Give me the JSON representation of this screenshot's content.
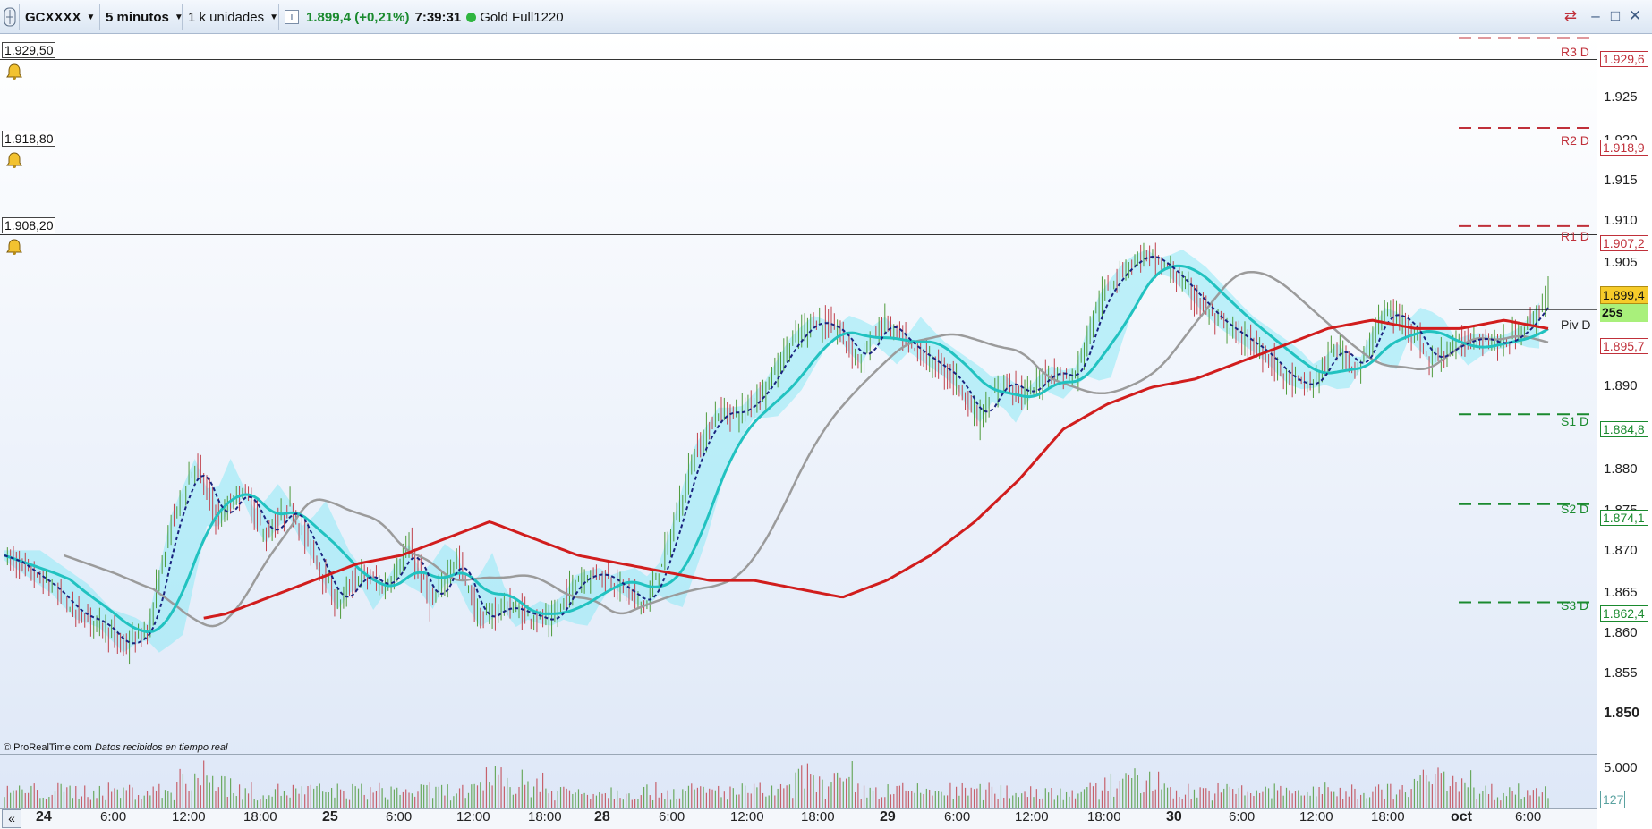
{
  "toolbar": {
    "symbol": "GCXXXX",
    "timeframe": "5 minutos",
    "units": "1 k unidades",
    "price_change": "1.899,4 (+0,21%)",
    "time": "7:39:31",
    "feed": "Gold Full1220",
    "icons": [
      "grid-icon",
      "info-icon",
      "status-dot-icon",
      "swap-icon",
      "minimize-icon",
      "maximize-icon",
      "close-icon"
    ]
  },
  "alerts": [
    "1.929,50",
    "1.918,80",
    "1.908,20"
  ],
  "pivots": [
    {
      "name": "R3 D",
      "value": "1.929,6",
      "color": "#c0303a"
    },
    {
      "name": "R2 D",
      "value": "1.918,9",
      "color": "#c0303a"
    },
    {
      "name": "R1 D",
      "value": "1.907,2",
      "color": "#c0303a"
    },
    {
      "name": "Piv D",
      "value": "1.895,7",
      "color": "#c0303a"
    },
    {
      "name": "S1 D",
      "value": "1.884,8",
      "color": "#1a8a2e"
    },
    {
      "name": "S2 D",
      "value": "1.874,1",
      "color": "#1a8a2e"
    },
    {
      "name": "S3 D",
      "value": "1.862,4",
      "color": "#1a8a2e"
    }
  ],
  "y_axis": {
    "ticks": [
      "1.925",
      "1.920",
      "1.915",
      "1.910",
      "1.905",
      "1.890",
      "1.880",
      "1.875",
      "1.870",
      "1.865",
      "1.860",
      "1.855",
      "1.850"
    ],
    "current_price": "1.899,4",
    "countdown": "25s",
    "volume_tick": "5.000",
    "volume_current": "127"
  },
  "x_axis": {
    "ticks": [
      {
        "label": "24",
        "day": true
      },
      {
        "label": "6:00"
      },
      {
        "label": "12:00"
      },
      {
        "label": "18:00"
      },
      {
        "label": "25",
        "day": true
      },
      {
        "label": "6:00"
      },
      {
        "label": "12:00"
      },
      {
        "label": "18:00"
      },
      {
        "label": "28",
        "day": true
      },
      {
        "label": "6:00"
      },
      {
        "label": "12:00"
      },
      {
        "label": "18:00"
      },
      {
        "label": "29",
        "day": true
      },
      {
        "label": "6:00"
      },
      {
        "label": "12:00"
      },
      {
        "label": "18:00"
      },
      {
        "label": "30",
        "day": true
      },
      {
        "label": "6:00"
      },
      {
        "label": "12:00"
      },
      {
        "label": "18:00"
      },
      {
        "label": "oct",
        "day": true
      },
      {
        "label": "6:00"
      }
    ]
  },
  "footer": {
    "copyright": "© ProRealTime.com",
    "realtime": "Datos recibidos en tiempo real",
    "scroll_icon": "double-left-arrow-icon"
  },
  "colors": {
    "up": "#4e9a3a",
    "down": "#c0404a",
    "ma_red": "#d11d1d",
    "ma_cyan": "#21c2c0",
    "ma_gray": "#9b9b9b",
    "ma_dashed": "#1a237e",
    "cloud": "#8eeaf5"
  },
  "chart_data": {
    "type": "line",
    "title": "",
    "series": [
      {
        "values": [
          1868,
          1866,
          1864,
          1861,
          1860,
          1857,
          1859,
          1872,
          1879,
          1872,
          1876,
          1870,
          1874,
          1868,
          1862,
          1866,
          1864,
          1869,
          1862,
          1868,
          1860,
          1862,
          1861,
          1860,
          1865,
          1866,
          1864,
          1862,
          1870,
          1880,
          1885,
          1885,
          1888,
          1893,
          1896,
          1895,
          1891,
          1896,
          1893,
          1891,
          1889,
          1884,
          1889,
          1887,
          1890,
          1889,
          1898,
          1902,
          1904,
          1902,
          1899,
          1896,
          1894,
          1892,
          1889,
          1888,
          1893,
          1890,
          1897,
          1896,
          1891,
          1893,
          1894,
          1893,
          1895,
          1899
        ]
      },
      {
        "values": [
          1862,
          1861,
          1861,
          1860,
          1860,
          1861,
          1863,
          1865,
          1867,
          1868,
          1870,
          1872,
          1870,
          1868,
          1867,
          1866,
          1865,
          1865,
          1864,
          1863,
          1865,
          1868,
          1872,
          1877,
          1883,
          1886,
          1888,
          1889,
          1891,
          1893,
          1895,
          1896,
          1895,
          1895,
          1896,
          1895
        ]
      }
    ],
    "ylim": [
      1850,
      1932
    ],
    "grid": false
  }
}
